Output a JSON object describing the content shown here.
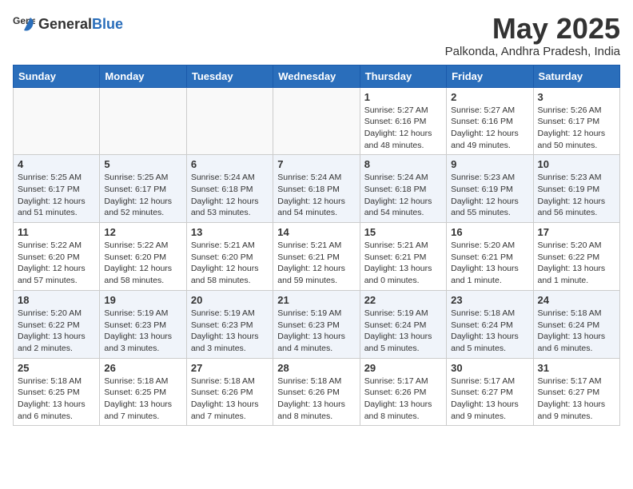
{
  "header": {
    "logo_general": "General",
    "logo_blue": "Blue",
    "month_year": "May 2025",
    "location": "Palkonda, Andhra Pradesh, India"
  },
  "weekdays": [
    "Sunday",
    "Monday",
    "Tuesday",
    "Wednesday",
    "Thursday",
    "Friday",
    "Saturday"
  ],
  "weeks": [
    [
      {
        "day": "",
        "detail": ""
      },
      {
        "day": "",
        "detail": ""
      },
      {
        "day": "",
        "detail": ""
      },
      {
        "day": "",
        "detail": ""
      },
      {
        "day": "1",
        "detail": "Sunrise: 5:27 AM\nSunset: 6:16 PM\nDaylight: 12 hours\nand 48 minutes."
      },
      {
        "day": "2",
        "detail": "Sunrise: 5:27 AM\nSunset: 6:16 PM\nDaylight: 12 hours\nand 49 minutes."
      },
      {
        "day": "3",
        "detail": "Sunrise: 5:26 AM\nSunset: 6:17 PM\nDaylight: 12 hours\nand 50 minutes."
      }
    ],
    [
      {
        "day": "4",
        "detail": "Sunrise: 5:25 AM\nSunset: 6:17 PM\nDaylight: 12 hours\nand 51 minutes."
      },
      {
        "day": "5",
        "detail": "Sunrise: 5:25 AM\nSunset: 6:17 PM\nDaylight: 12 hours\nand 52 minutes."
      },
      {
        "day": "6",
        "detail": "Sunrise: 5:24 AM\nSunset: 6:18 PM\nDaylight: 12 hours\nand 53 minutes."
      },
      {
        "day": "7",
        "detail": "Sunrise: 5:24 AM\nSunset: 6:18 PM\nDaylight: 12 hours\nand 54 minutes."
      },
      {
        "day": "8",
        "detail": "Sunrise: 5:24 AM\nSunset: 6:18 PM\nDaylight: 12 hours\nand 54 minutes."
      },
      {
        "day": "9",
        "detail": "Sunrise: 5:23 AM\nSunset: 6:19 PM\nDaylight: 12 hours\nand 55 minutes."
      },
      {
        "day": "10",
        "detail": "Sunrise: 5:23 AM\nSunset: 6:19 PM\nDaylight: 12 hours\nand 56 minutes."
      }
    ],
    [
      {
        "day": "11",
        "detail": "Sunrise: 5:22 AM\nSunset: 6:20 PM\nDaylight: 12 hours\nand 57 minutes."
      },
      {
        "day": "12",
        "detail": "Sunrise: 5:22 AM\nSunset: 6:20 PM\nDaylight: 12 hours\nand 58 minutes."
      },
      {
        "day": "13",
        "detail": "Sunrise: 5:21 AM\nSunset: 6:20 PM\nDaylight: 12 hours\nand 58 minutes."
      },
      {
        "day": "14",
        "detail": "Sunrise: 5:21 AM\nSunset: 6:21 PM\nDaylight: 12 hours\nand 59 minutes."
      },
      {
        "day": "15",
        "detail": "Sunrise: 5:21 AM\nSunset: 6:21 PM\nDaylight: 13 hours\nand 0 minutes."
      },
      {
        "day": "16",
        "detail": "Sunrise: 5:20 AM\nSunset: 6:21 PM\nDaylight: 13 hours\nand 1 minute."
      },
      {
        "day": "17",
        "detail": "Sunrise: 5:20 AM\nSunset: 6:22 PM\nDaylight: 13 hours\nand 1 minute."
      }
    ],
    [
      {
        "day": "18",
        "detail": "Sunrise: 5:20 AM\nSunset: 6:22 PM\nDaylight: 13 hours\nand 2 minutes."
      },
      {
        "day": "19",
        "detail": "Sunrise: 5:19 AM\nSunset: 6:23 PM\nDaylight: 13 hours\nand 3 minutes."
      },
      {
        "day": "20",
        "detail": "Sunrise: 5:19 AM\nSunset: 6:23 PM\nDaylight: 13 hours\nand 3 minutes."
      },
      {
        "day": "21",
        "detail": "Sunrise: 5:19 AM\nSunset: 6:23 PM\nDaylight: 13 hours\nand 4 minutes."
      },
      {
        "day": "22",
        "detail": "Sunrise: 5:19 AM\nSunset: 6:24 PM\nDaylight: 13 hours\nand 5 minutes."
      },
      {
        "day": "23",
        "detail": "Sunrise: 5:18 AM\nSunset: 6:24 PM\nDaylight: 13 hours\nand 5 minutes."
      },
      {
        "day": "24",
        "detail": "Sunrise: 5:18 AM\nSunset: 6:24 PM\nDaylight: 13 hours\nand 6 minutes."
      }
    ],
    [
      {
        "day": "25",
        "detail": "Sunrise: 5:18 AM\nSunset: 6:25 PM\nDaylight: 13 hours\nand 6 minutes."
      },
      {
        "day": "26",
        "detail": "Sunrise: 5:18 AM\nSunset: 6:25 PM\nDaylight: 13 hours\nand 7 minutes."
      },
      {
        "day": "27",
        "detail": "Sunrise: 5:18 AM\nSunset: 6:26 PM\nDaylight: 13 hours\nand 7 minutes."
      },
      {
        "day": "28",
        "detail": "Sunrise: 5:18 AM\nSunset: 6:26 PM\nDaylight: 13 hours\nand 8 minutes."
      },
      {
        "day": "29",
        "detail": "Sunrise: 5:17 AM\nSunset: 6:26 PM\nDaylight: 13 hours\nand 8 minutes."
      },
      {
        "day": "30",
        "detail": "Sunrise: 5:17 AM\nSunset: 6:27 PM\nDaylight: 13 hours\nand 9 minutes."
      },
      {
        "day": "31",
        "detail": "Sunrise: 5:17 AM\nSunset: 6:27 PM\nDaylight: 13 hours\nand 9 minutes."
      }
    ]
  ]
}
